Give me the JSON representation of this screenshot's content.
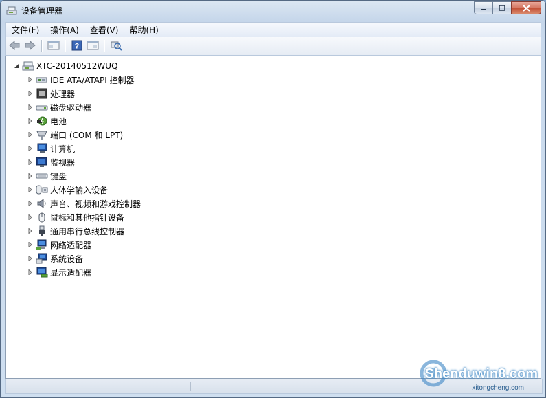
{
  "window": {
    "title": "设备管理器"
  },
  "menubar": {
    "items": [
      "文件(F)",
      "操作(A)",
      "查看(V)",
      "帮助(H)"
    ]
  },
  "toolbar": {
    "buttons": [
      "back-arrow-icon",
      "forward-arrow-icon",
      "console-tree-icon",
      "help-icon",
      "properties-icon",
      "scan-hardware-icon"
    ]
  },
  "tree": {
    "root": "XTC-20140512WUQ",
    "items": [
      {
        "label": "IDE ATA/ATAPI 控制器",
        "icon": "ide-controller-icon"
      },
      {
        "label": "处理器",
        "icon": "processor-icon"
      },
      {
        "label": "磁盘驱动器",
        "icon": "disk-drive-icon"
      },
      {
        "label": "电池",
        "icon": "battery-icon"
      },
      {
        "label": "端口 (COM 和 LPT)",
        "icon": "port-icon"
      },
      {
        "label": "计算机",
        "icon": "computer-icon"
      },
      {
        "label": "监视器",
        "icon": "monitor-icon"
      },
      {
        "label": "键盘",
        "icon": "keyboard-icon"
      },
      {
        "label": "人体学输入设备",
        "icon": "hid-icon"
      },
      {
        "label": "声音、视频和游戏控制器",
        "icon": "sound-icon"
      },
      {
        "label": "鼠标和其他指针设备",
        "icon": "mouse-icon"
      },
      {
        "label": "通用串行总线控制器",
        "icon": "usb-icon"
      },
      {
        "label": "网络适配器",
        "icon": "network-adapter-icon"
      },
      {
        "label": "系统设备",
        "icon": "system-device-icon"
      },
      {
        "label": "显示适配器",
        "icon": "display-adapter-icon"
      }
    ]
  },
  "watermark": {
    "main": "Shenduwin8.com",
    "sub": "xitongcheng.com"
  }
}
